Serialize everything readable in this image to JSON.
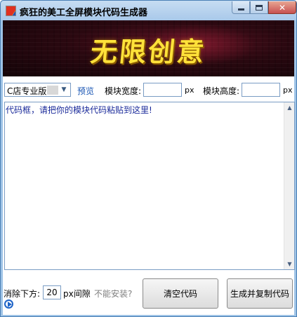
{
  "window": {
    "title": "疯狂的美工全屏模块代码生成器",
    "minimize_icon": "minimize-icon",
    "maximize_icon": "maximize-icon",
    "close_label": "✕"
  },
  "banner": {
    "text": "无限创意"
  },
  "toolbar": {
    "version_select": {
      "value": "C店专业版",
      "options": [
        "C店专业版"
      ]
    },
    "preview_label": "预览",
    "width_label": "模块宽度:",
    "width_value": "",
    "width_unit": "px",
    "height_label": "模块高度:",
    "height_value": "",
    "height_unit": "px"
  },
  "editor": {
    "placeholder": "代码框，请把你的模块代码粘贴到这里!",
    "value": ""
  },
  "footer": {
    "remove_below_label": "消除下方:",
    "gap_value": "20",
    "gap_unit_label": "px间隙",
    "cant_install_label": "不能安装?",
    "clear_button": "清空代码",
    "generate_button": "生成并复制代码"
  },
  "colors": {
    "title_bar": "#b8d3ee",
    "banner_text": "#ffe23a",
    "banner_bg": "#2a0810",
    "link_blue": "#1a56b4",
    "placeholder_blue": "#1a2a9a",
    "muted_gray": "#808080"
  }
}
